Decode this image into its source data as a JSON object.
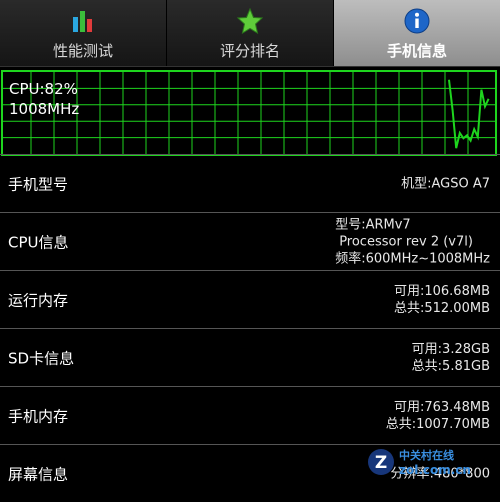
{
  "tabs": [
    {
      "label": "性能测试",
      "icon": "bar-chart-icon",
      "active": false
    },
    {
      "label": "评分排名",
      "icon": "star-icon",
      "active": false
    },
    {
      "label": "手机信息",
      "icon": "info-icon",
      "active": true
    }
  ],
  "monitor": {
    "cpu_usage": "CPU:82%",
    "cpu_freq": "1008MHz",
    "usage_fraction": 0.82,
    "line_color": "#1ed51e"
  },
  "rows": [
    {
      "label": "手机型号",
      "values": [
        "机型:AGSO A7"
      ]
    },
    {
      "label": "CPU信息",
      "values": [
        "型号:ARMv7",
        "Processor rev 2 (v7l)",
        "频率:600MHz~1008MHz"
      ]
    },
    {
      "label": "运行内存",
      "values": [
        "可用:106.68MB",
        "总共:512.00MB"
      ]
    },
    {
      "label": "SD卡信息",
      "values": [
        "可用:3.28GB",
        "总共:5.81GB"
      ]
    },
    {
      "label": "手机内存",
      "values": [
        "可用:763.48MB",
        "总共:1007.70MB"
      ]
    },
    {
      "label": "屏幕信息",
      "values": [
        "分辨率:480*800"
      ]
    }
  ],
  "watermark": {
    "brand": "中关村在线",
    "site": "zol.com.cn"
  }
}
